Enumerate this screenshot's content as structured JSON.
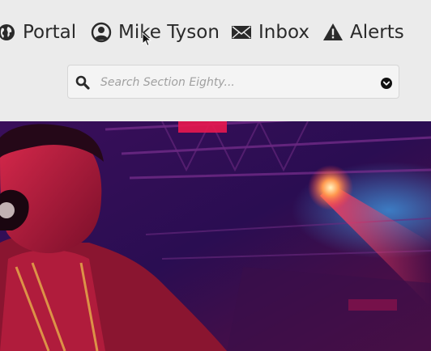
{
  "nav": {
    "portal_label": "Portal",
    "user_label": "Mike Tyson",
    "inbox_label": "Inbox",
    "alerts_label": "Alerts"
  },
  "search": {
    "placeholder": "Search Section Eighty...",
    "value": ""
  },
  "icons": {
    "portal": "globe-icon",
    "user": "user-circle-icon",
    "inbox": "envelope-icon",
    "alerts": "warning-icon",
    "search": "search-icon",
    "dropdown": "chevron-down-circle-icon"
  },
  "colors": {
    "page_bg": "#ebebeb",
    "text": "#2a2a2a",
    "hero_bg": "#2a0d52",
    "hero_accent": "#e8184f"
  }
}
